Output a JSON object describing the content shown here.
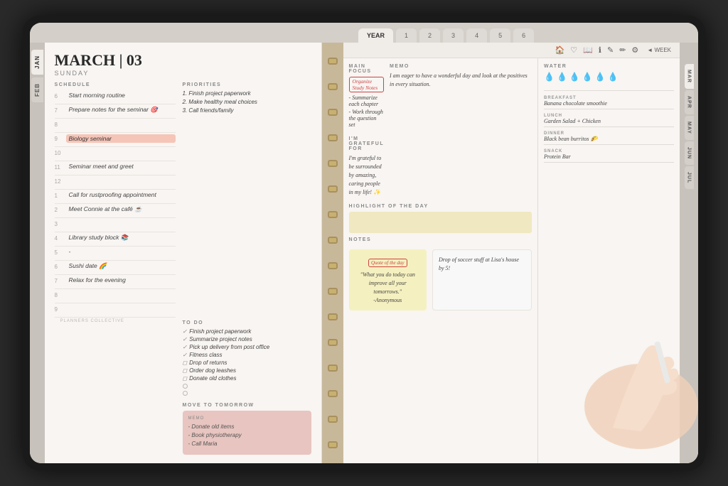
{
  "tablet": {
    "top_tabs": {
      "spacer_label": "",
      "tabs": [
        "YEAR",
        "1",
        "2",
        "3",
        "4",
        "5",
        "6"
      ],
      "active_tab": "YEAR"
    },
    "side_tabs_left": [
      "JAN",
      "FEB"
    ],
    "side_tabs_right": [
      "MAR",
      "APR",
      "MAY",
      "JUN",
      "JUL"
    ],
    "header_icons": [
      "🏠",
      "♡",
      "📖",
      "ℹ",
      "✎",
      "✏",
      "⚙"
    ],
    "week_label": "◄ WEEK"
  },
  "left_page": {
    "date": "MARCH | 03",
    "day": "SUNDAY",
    "schedule_label": "SCHEDULE",
    "times": [
      {
        "time": "6",
        "entry": "Start morning routine",
        "highlighted": false
      },
      {
        "time": "7",
        "entry": "Prepare notes for the seminar 🎯",
        "highlighted": false
      },
      {
        "time": "8",
        "entry": "",
        "highlighted": false
      },
      {
        "time": "9",
        "entry": "Biology seminar",
        "highlighted": true
      },
      {
        "time": "10",
        "entry": "",
        "highlighted": false
      },
      {
        "time": "11",
        "entry": "Seminar meet and greet",
        "highlighted": false
      },
      {
        "time": "12",
        "entry": "",
        "highlighted": false
      },
      {
        "time": "1",
        "entry": "Call for rustproofing appointment",
        "highlighted": false
      },
      {
        "time": "2",
        "entry": "Meet Connie at the café ☕",
        "highlighted": false
      },
      {
        "time": "3",
        "entry": "",
        "highlighted": false
      },
      {
        "time": "4",
        "entry": "Library study block 📚",
        "highlighted": false
      },
      {
        "time": "5",
        "entry": "-",
        "highlighted": false
      },
      {
        "time": "6",
        "entry": "Sushi date 🌈",
        "highlighted": false
      },
      {
        "time": "7",
        "entry": "Relax for the evening",
        "highlighted": false
      },
      {
        "time": "8",
        "entry": "",
        "highlighted": false
      },
      {
        "time": "9",
        "entry": "",
        "highlighted": false
      }
    ],
    "priorities_label": "PRIORITIES",
    "priorities": [
      "1. Finish project paperwork",
      "2. Make healthy meal choices",
      "3. Call friends/family"
    ],
    "todo_label": "TO DO",
    "todos": [
      {
        "text": "Finish project paperwork",
        "checked": true
      },
      {
        "text": "Summarize project notes",
        "checked": true
      },
      {
        "text": "Pick up delivery from post office",
        "checked": true
      },
      {
        "text": "Fitness class",
        "checked": true
      },
      {
        "text": "Drop of returns",
        "checked": false
      },
      {
        "text": "Order dog leashes",
        "checked": false
      },
      {
        "text": "Donate old clothes",
        "checked": false
      },
      {
        "text": "",
        "checked": false
      },
      {
        "text": "",
        "checked": false
      },
      {
        "text": "",
        "checked": false
      }
    ],
    "move_tomorrow_label": "MOVE TO TOMORROW",
    "memo_label": "MEMO",
    "memo_items": [
      "- Donate old items",
      "- Book physiotherapy",
      "- Call Maria"
    ]
  },
  "right_page": {
    "main_focus_label": "MAIN FOCUS",
    "focus_tag": "Organize Study Notes",
    "focus_items": [
      "- Summarize each chapter",
      "- Work through the question set"
    ],
    "memo_label": "MEMO",
    "memo_text": "I am eager to have a wonderful day and look at the positives in every situation.",
    "grateful_label": "I'M GRATEFUL FOR",
    "grateful_text": "I'm grateful to be surrounded by amazing, caring people in my life! ✨",
    "highlight_label": "HIGHLIGHT OF THE DAY",
    "notes_label": "NOTES",
    "quote_tag": "Quote of the day",
    "quote_text": "\"What you do today can improve all your tomorrows.\"",
    "quote_author": "-Anonymous",
    "sticky_text": "Drop of soccer stuff at Lisa's house by 5!",
    "water_label": "WATER",
    "drops": [
      "💧",
      "💧",
      "💧",
      "💧",
      "💧",
      "💧"
    ],
    "meals": [
      {
        "label": "BREAKFAST",
        "text": "Banana chocolate smoothie"
      },
      {
        "label": "LUNCH",
        "text": "Garden Salad + Chicken"
      },
      {
        "label": "DINNER",
        "text": "Black bean burritos 🌮"
      },
      {
        "label": "SNACK",
        "text": "Protein Bar"
      }
    ],
    "brand": "PLANNERS COLLECTIVE"
  }
}
